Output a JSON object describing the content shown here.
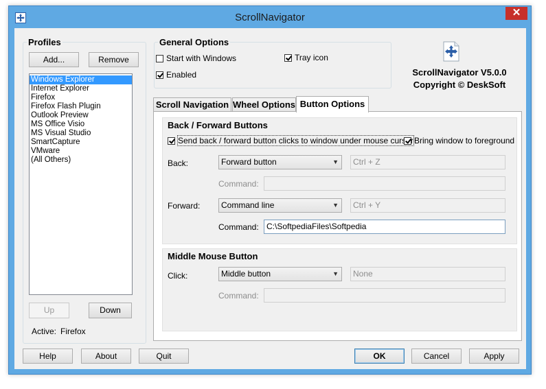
{
  "window": {
    "title": "ScrollNavigator",
    "close_label": "✕"
  },
  "profiles": {
    "title": "Profiles",
    "add_label": "Add...",
    "remove_label": "Remove",
    "items": [
      "Windows Explorer",
      "Internet Explorer",
      "Firefox",
      "Firefox Flash Plugin",
      "Outlook Preview",
      "MS Office Visio",
      "MS Visual Studio",
      "SmartCapture",
      "VMware",
      "(All Others)"
    ],
    "selected": "Windows Explorer",
    "up_label": "Up",
    "down_label": "Down",
    "active_label": "Active:",
    "active_value": "Firefox"
  },
  "general": {
    "title": "General Options",
    "start_with_windows": {
      "label": "Start with Windows",
      "checked": false
    },
    "tray_icon": {
      "label": "Tray icon",
      "checked": true
    },
    "enabled": {
      "label": "Enabled",
      "checked": true
    }
  },
  "about": {
    "product": "ScrollNavigator V5.0.0",
    "copyright": "Copyright © DeskSoft"
  },
  "tabs": [
    {
      "label": "Scroll Navigation",
      "active": false
    },
    {
      "label": "Wheel Options",
      "active": false
    },
    {
      "label": "Button Options",
      "active": true
    }
  ],
  "back_forward": {
    "title": "Back / Forward Buttons",
    "send_clicks": {
      "label": "Send back / forward button clicks to window under mouse cursor",
      "checked": true
    },
    "bring_foreground": {
      "label": "Bring window to foreground",
      "checked": true
    },
    "back": {
      "label": "Back:",
      "action": "Forward button",
      "hotkey": "Ctrl + Z",
      "command_label": "Command:",
      "command_value": ""
    },
    "forward": {
      "label": "Forward:",
      "action": "Command line",
      "hotkey": "Ctrl + Y",
      "command_label": "Command:",
      "command_value": "C:\\SoftpediaFiles\\Softpedia"
    }
  },
  "middle": {
    "title": "Middle Mouse Button",
    "click_label": "Click:",
    "action": "Middle button",
    "hotkey": "None",
    "command_label": "Command:",
    "command_value": ""
  },
  "footer": {
    "help": "Help",
    "about": "About",
    "quit": "Quit",
    "ok": "OK",
    "cancel": "Cancel",
    "apply": "Apply"
  },
  "colors": {
    "titlebar": "#5fa9e3",
    "close": "#c7302a",
    "selection": "#3399ff"
  }
}
